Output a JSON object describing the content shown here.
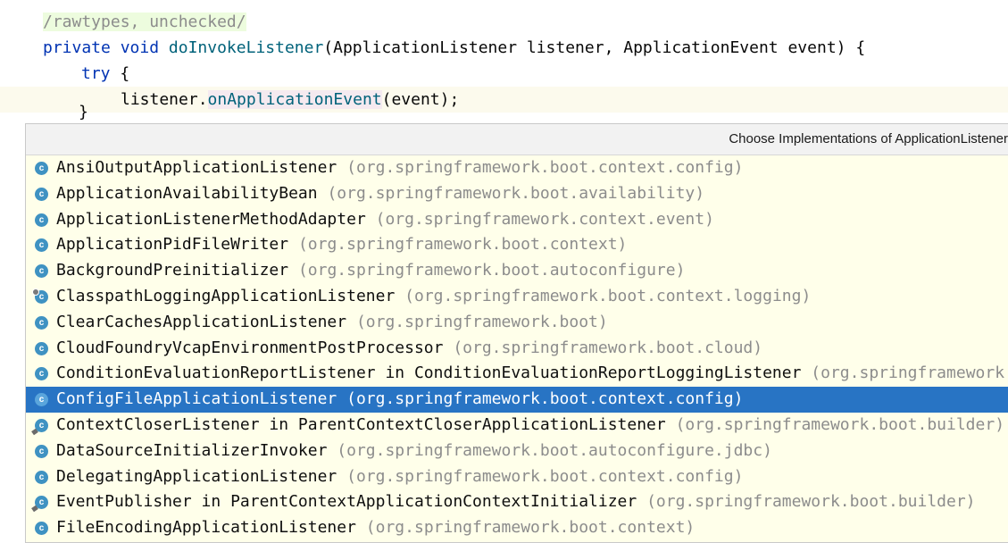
{
  "editor": {
    "line1": "/rawtypes, unchecked/",
    "line2": {
      "kw1": "private",
      "kw2": "void",
      "method": "doInvokeListener",
      "rest": "(ApplicationListener listener, ApplicationEvent event) {"
    },
    "line3": {
      "kw": "try",
      "rest": " {"
    },
    "line4": {
      "obj": "listener.",
      "call": "onApplicationEvent",
      "rest": "(event);"
    },
    "line5": "}"
  },
  "popup": {
    "title": "Choose Implementations of ApplicationListener",
    "items": [
      {
        "name": "AnsiOutputApplicationListener",
        "pkg": "(org.springframework.boot.context.config)",
        "icon": "class-icon",
        "selected": false
      },
      {
        "name": "ApplicationAvailabilityBean",
        "pkg": "(org.springframework.boot.availability)",
        "icon": "class-icon",
        "selected": false
      },
      {
        "name": "ApplicationListenerMethodAdapter",
        "pkg": "(org.springframework.context.event)",
        "icon": "class-icon",
        "selected": false
      },
      {
        "name": "ApplicationPidFileWriter",
        "pkg": "(org.springframework.boot.context)",
        "icon": "class-icon",
        "selected": false
      },
      {
        "name": "BackgroundPreinitializer",
        "pkg": "(org.springframework.boot.autoconfigure)",
        "icon": "class-icon",
        "selected": false
      },
      {
        "name": "ClasspathLoggingApplicationListener",
        "pkg": "(org.springframework.boot.context.logging)",
        "icon": "library-class-icon",
        "selected": false
      },
      {
        "name": "ClearCachesApplicationListener",
        "pkg": "(org.springframework.boot)",
        "icon": "class-icon",
        "selected": false
      },
      {
        "name": "CloudFoundryVcapEnvironmentPostProcessor",
        "pkg": "(org.springframework.boot.cloud)",
        "icon": "class-icon",
        "selected": false
      },
      {
        "name": "ConditionEvaluationReportListener in ConditionEvaluationReportLoggingListener",
        "pkg": "(org.springframework.boot.autoconfigure.logging)",
        "icon": "class-icon",
        "selected": false
      },
      {
        "name": "ConfigFileApplicationListener",
        "pkg": "(org.springframework.boot.context.config)",
        "icon": "class-icon",
        "selected": true
      },
      {
        "name": "ContextCloserListener in ParentContextCloserApplicationListener",
        "pkg": "(org.springframework.boot.builder)",
        "icon": "inner-class-icon",
        "selected": false
      },
      {
        "name": "DataSourceInitializerInvoker",
        "pkg": "(org.springframework.boot.autoconfigure.jdbc)",
        "icon": "class-icon",
        "selected": false
      },
      {
        "name": "DelegatingApplicationListener",
        "pkg": "(org.springframework.boot.context.config)",
        "icon": "class-icon",
        "selected": false
      },
      {
        "name": "EventPublisher in ParentContextApplicationContextInitializer",
        "pkg": "(org.springframework.boot.builder)",
        "icon": "inner-class-icon",
        "selected": false
      },
      {
        "name": "FileEncodingApplicationListener",
        "pkg": "(org.springframework.boot.context)",
        "icon": "class-icon",
        "selected": false
      }
    ]
  }
}
